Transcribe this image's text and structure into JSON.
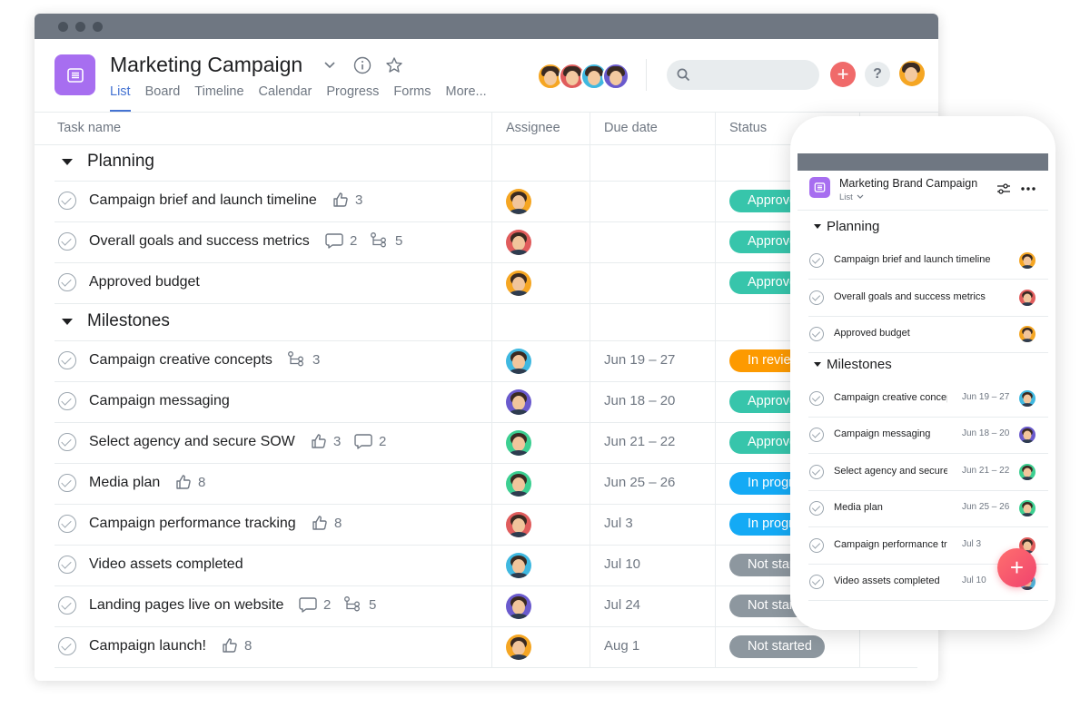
{
  "desktop": {
    "project_title": "Marketing Campaign",
    "tabs": [
      "List",
      "Board",
      "Timeline",
      "Calendar",
      "Progress",
      "Forms",
      "More..."
    ],
    "active_tab": "List",
    "columns": {
      "task": "Task name",
      "assignee": "Assignee",
      "due": "Due date",
      "status": "Status"
    },
    "sections": [
      {
        "name": "Planning",
        "tasks": [
          {
            "name": "Campaign brief and launch timeline",
            "likes": "3",
            "comments": null,
            "subtasks": null,
            "assignee_color": "#f5a623",
            "due": "",
            "status": "Approved",
            "status_color": "#37c5ab"
          },
          {
            "name": "Overall goals and success metrics",
            "likes": null,
            "comments": "2",
            "subtasks": "5",
            "assignee_color": "#e05c5c",
            "due": "",
            "status": "Approved",
            "status_color": "#37c5ab"
          },
          {
            "name": "Approved budget",
            "likes": null,
            "comments": null,
            "subtasks": null,
            "assignee_color": "#f5a623",
            "due": "",
            "status": "Approved",
            "status_color": "#37c5ab"
          }
        ]
      },
      {
        "name": "Milestones",
        "tasks": [
          {
            "name": "Campaign creative concepts",
            "likes": null,
            "comments": null,
            "subtasks": "3",
            "assignee_color": "#3fb8e0",
            "due": "Jun 19 – 27",
            "status": "In review",
            "status_color": "#fd9a00"
          },
          {
            "name": "Campaign messaging",
            "likes": null,
            "comments": null,
            "subtasks": null,
            "assignee_color": "#6a5acd",
            "due": "Jun 18 – 20",
            "status": "Approved",
            "status_color": "#37c5ab"
          },
          {
            "name": "Select agency and secure SOW",
            "likes": "3",
            "comments": "2",
            "subtasks": null,
            "assignee_color": "#3ccf91",
            "due": "Jun 21 – 22",
            "status": "Approved",
            "status_color": "#37c5ab"
          },
          {
            "name": "Media plan",
            "likes": "8",
            "comments": null,
            "subtasks": null,
            "assignee_color": "#3ccf91",
            "due": "Jun 25 – 26",
            "status": "In progress",
            "status_color": "#14aaf5"
          },
          {
            "name": "Campaign performance tracking",
            "likes": "8",
            "comments": null,
            "subtasks": null,
            "assignee_color": "#e05c5c",
            "due": "Jul 3",
            "status": "In progress",
            "status_color": "#14aaf5"
          },
          {
            "name": "Video assets completed",
            "likes": null,
            "comments": null,
            "subtasks": null,
            "assignee_color": "#3fb8e0",
            "due": "Jul 10",
            "status": "Not started",
            "status_color": "#8d979f"
          },
          {
            "name": "Landing pages live on website",
            "likes": null,
            "comments": "2",
            "subtasks": "5",
            "assignee_color": "#6a5acd",
            "due": "Jul 24",
            "status": "Not started",
            "status_color": "#8d979f"
          },
          {
            "name": "Campaign launch!",
            "likes": "8",
            "comments": null,
            "subtasks": null,
            "assignee_color": "#f5a623",
            "due": "Aug 1",
            "status": "Not started",
            "status_color": "#8d979f"
          }
        ]
      }
    ]
  },
  "mobile": {
    "project_title": "Marketing Brand Campaign",
    "view_label": "List",
    "sections": [
      {
        "name": "Planning",
        "tasks": [
          {
            "name": "Campaign brief and launch timeline",
            "due": "",
            "assignee_color": "#f5a623"
          },
          {
            "name": "Overall goals and success metrics",
            "due": "",
            "assignee_color": "#e05c5c"
          },
          {
            "name": "Approved budget",
            "due": "",
            "assignee_color": "#f5a623"
          }
        ]
      },
      {
        "name": "Milestones",
        "tasks": [
          {
            "name": "Campaign creative concepts",
            "due": "Jun 19 – 27",
            "assignee_color": "#3fb8e0"
          },
          {
            "name": "Campaign messaging",
            "due": "Jun 18 – 20",
            "assignee_color": "#6a5acd"
          },
          {
            "name": "Select agency and secure SOW",
            "due": "Jun 21 – 22",
            "assignee_color": "#3ccf91"
          },
          {
            "name": "Media plan",
            "due": "Jun 25 – 26",
            "assignee_color": "#3ccf91"
          },
          {
            "name": "Campaign performance tracking",
            "due": "Jul 3",
            "assignee_color": "#e05c5c"
          },
          {
            "name": "Video assets completed",
            "due": "Jul 10",
            "assignee_color": "#3fb8e0"
          }
        ]
      }
    ]
  },
  "icons": {
    "project": "list-icon",
    "dropdown": "chevron-down-icon",
    "info": "info-icon",
    "favorite": "star-icon",
    "search": "search-icon",
    "add": "plus-icon",
    "help": "question-icon",
    "like": "thumbs-up-icon",
    "comment": "comment-icon",
    "subtask": "subtask-icon",
    "filter": "filter-icon",
    "more": "more-icon"
  },
  "colors": {
    "accent": "#4573d2",
    "project_icon": "#a76ef0",
    "add_button": "#f06a6a"
  },
  "help_label": "?",
  "add_label": "+"
}
